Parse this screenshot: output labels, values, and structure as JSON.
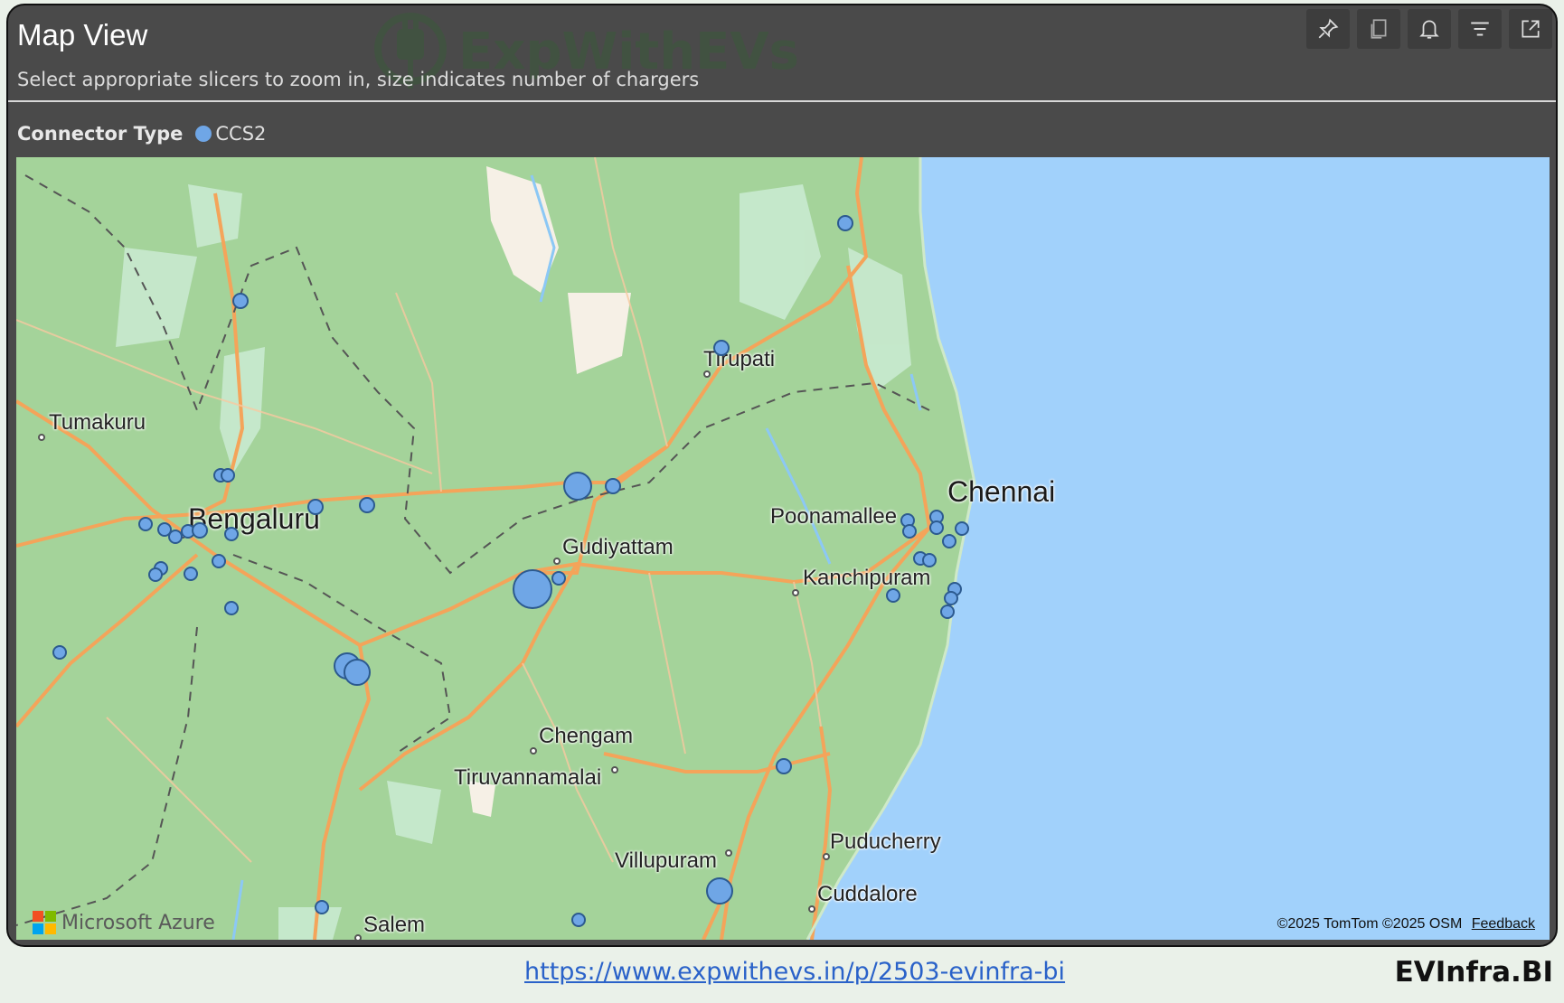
{
  "visual": {
    "title": "Map View",
    "subtitle": "Select appropriate slicers to zoom in, size indicates number of chargers",
    "watermark": "ExpWithEVs"
  },
  "toolbar": {
    "buttons": [
      {
        "name": "pin-button",
        "icon": "pin-icon"
      },
      {
        "name": "copy-visual-button",
        "icon": "copy-icon"
      },
      {
        "name": "set-alert-button",
        "icon": "bell-icon"
      },
      {
        "name": "filters-button",
        "icon": "filter-icon"
      },
      {
        "name": "focus-mode-button",
        "icon": "expand-icon"
      }
    ]
  },
  "legend": {
    "title": "Connector Type",
    "items": [
      {
        "label": "CCS2",
        "color": "#6fa6e6"
      }
    ]
  },
  "map": {
    "cities": [
      {
        "name": "Tirupati"
      },
      {
        "name": "Tumakuru"
      },
      {
        "name": "Bengaluru"
      },
      {
        "name": "Chennai"
      },
      {
        "name": "Poonamallee"
      },
      {
        "name": "Gudiyattam"
      },
      {
        "name": "Kanchipuram"
      },
      {
        "name": "Chengam"
      },
      {
        "name": "Tiruvannamalai"
      },
      {
        "name": "Puducherry"
      },
      {
        "name": "Villupuram"
      },
      {
        "name": "Cuddalore"
      },
      {
        "name": "Salem"
      }
    ],
    "provider": "Microsoft Azure",
    "attribution": "©2025 TomTom  ©2025 OSM",
    "feedback": "Feedback",
    "colors": {
      "land": "#a4d39a",
      "water": "#a1d1fb",
      "road": "#f4a45a",
      "marker": "#6fa6e6"
    }
  },
  "footer": {
    "url": "https://www.expwithevs.in/p/2503-evinfra-bi",
    "brand": "EVInfra.BI"
  }
}
